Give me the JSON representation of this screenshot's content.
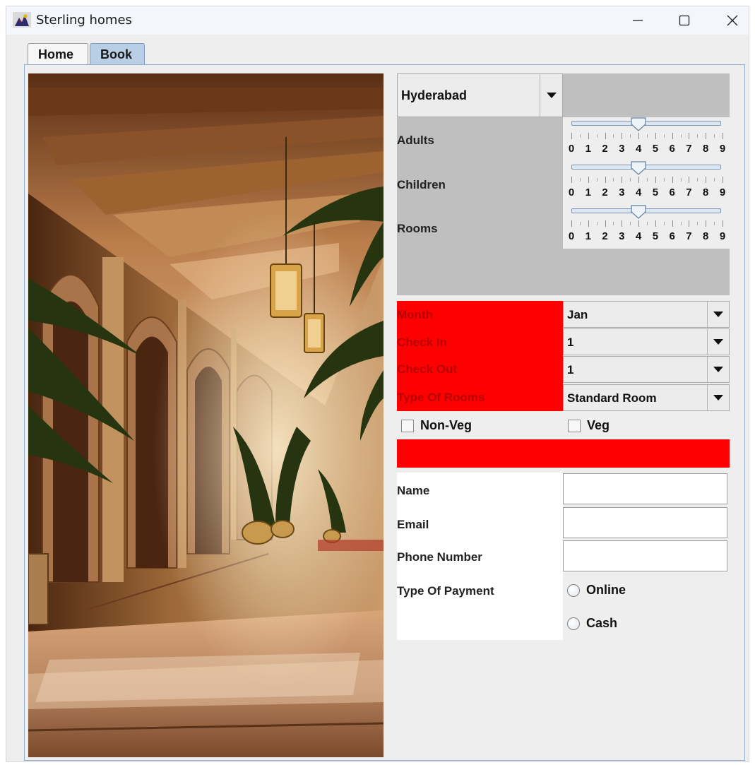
{
  "window": {
    "title": "Sterling homes"
  },
  "tabs": [
    {
      "label": "Home",
      "selected": false
    },
    {
      "label": "Book",
      "selected": true
    }
  ],
  "booking": {
    "city": {
      "value": "Hyderabad"
    },
    "sliders": [
      {
        "label": "Adults",
        "value": 4,
        "ticks": [
          "0",
          "1",
          "2",
          "3",
          "4",
          "5",
          "6",
          "7",
          "8",
          "9"
        ]
      },
      {
        "label": "Children",
        "value": 4,
        "ticks": [
          "0",
          "1",
          "2",
          "3",
          "4",
          "5",
          "6",
          "7",
          "8",
          "9"
        ]
      },
      {
        "label": "Rooms",
        "value": 4,
        "ticks": [
          "0",
          "1",
          "2",
          "3",
          "4",
          "5",
          "6",
          "7",
          "8",
          "9"
        ]
      }
    ],
    "selects": [
      {
        "label": "Month",
        "value": "Jan"
      },
      {
        "label": "Check In",
        "value": "1"
      },
      {
        "label": "Check Out",
        "value": "1"
      },
      {
        "label": "Type Of Rooms",
        "value": "Standard Room"
      }
    ],
    "food": [
      {
        "label": "Non-Veg",
        "checked": false
      },
      {
        "label": "Veg",
        "checked": false
      }
    ],
    "fields": [
      {
        "label": "Name",
        "value": ""
      },
      {
        "label": "Email",
        "value": ""
      },
      {
        "label": "Phone Number",
        "value": ""
      }
    ],
    "payment": {
      "label": "Type Of Payment",
      "options": [
        {
          "label": "Online",
          "selected": false
        },
        {
          "label": "Cash",
          "selected": false
        }
      ]
    }
  },
  "colors": {
    "red": "#ff0000",
    "red_label_text": "#b70000",
    "panel_gray": "#bfbfbf",
    "selected_tab": "#b8cfe5"
  }
}
